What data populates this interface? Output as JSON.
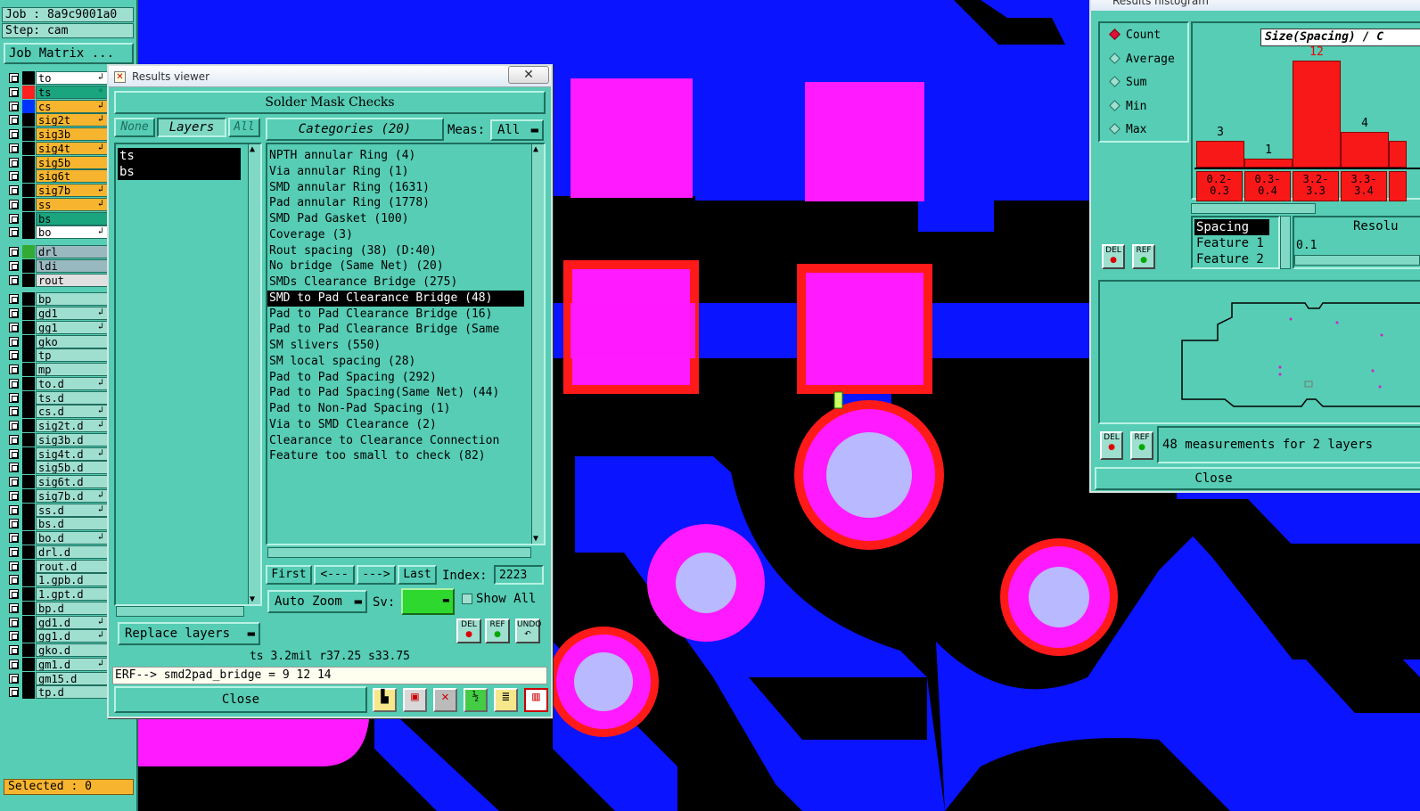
{
  "job_panel": {
    "job": "Job : 8a9c9001a0",
    "step": "Step: cam",
    "matrix_button": "Job Matrix ...",
    "layers": [
      {
        "name": "to",
        "color": "#ffffff",
        "swatch": "#000000",
        "mark": "↲"
      },
      {
        "name": "ts",
        "color": "#1aa57f",
        "swatch": "#ff2020",
        "mark": "◦"
      },
      {
        "name": "cs",
        "color": "#f7b52f",
        "swatch": "#0033ff",
        "mark": "↲"
      },
      {
        "name": "sig2t",
        "color": "#f7b52f",
        "swatch": "#000000",
        "mark": "↲"
      },
      {
        "name": "sig3b",
        "color": "#f7b52f",
        "swatch": "#000000",
        "mark": ""
      },
      {
        "name": "sig4t",
        "color": "#f7b52f",
        "swatch": "#000000",
        "mark": "↲"
      },
      {
        "name": "sig5b",
        "color": "#f7b52f",
        "swatch": "#000000",
        "mark": ""
      },
      {
        "name": "sig6t",
        "color": "#f7b52f",
        "swatch": "#000000",
        "mark": ""
      },
      {
        "name": "sig7b",
        "color": "#f7b52f",
        "swatch": "#000000",
        "mark": "↲"
      },
      {
        "name": "ss",
        "color": "#f7b52f",
        "swatch": "#000000",
        "mark": "↲"
      },
      {
        "name": "bs",
        "color": "#1aa57f",
        "swatch": "#000000",
        "mark": ""
      },
      {
        "name": "bo",
        "color": "#ffffff",
        "swatch": "#000000",
        "mark": "↲"
      },
      {
        "name": "drl",
        "color": "#9ab8c0",
        "swatch": "#33aa33",
        "mark": ""
      },
      {
        "name": "ldi",
        "color": "#9ab8c0",
        "swatch": "#000000",
        "mark": ""
      },
      {
        "name": "rout",
        "color": "#e0e0e0",
        "swatch": "#000000",
        "mark": ""
      },
      {
        "name": "bp",
        "color": "#9fdfd0",
        "swatch": "#000000",
        "mark": ""
      },
      {
        "name": "gd1",
        "color": "#9fdfd0",
        "swatch": "#000000",
        "mark": "↲"
      },
      {
        "name": "gg1",
        "color": "#9fdfd0",
        "swatch": "#000000",
        "mark": "↲"
      },
      {
        "name": "gko",
        "color": "#9fdfd0",
        "swatch": "#000000",
        "mark": ""
      },
      {
        "name": "tp",
        "color": "#9fdfd0",
        "swatch": "#000000",
        "mark": ""
      },
      {
        "name": "mp",
        "color": "#9fdfd0",
        "swatch": "#000000",
        "mark": ""
      },
      {
        "name": "to.d",
        "color": "#9fdfd0",
        "swatch": "#000000",
        "mark": "↲"
      },
      {
        "name": "ts.d",
        "color": "#9fdfd0",
        "swatch": "#000000",
        "mark": ""
      },
      {
        "name": "cs.d",
        "color": "#9fdfd0",
        "swatch": "#000000",
        "mark": "↲"
      },
      {
        "name": "sig2t.d",
        "color": "#9fdfd0",
        "swatch": "#000000",
        "mark": "↲"
      },
      {
        "name": "sig3b.d",
        "color": "#9fdfd0",
        "swatch": "#000000",
        "mark": ""
      },
      {
        "name": "sig4t.d",
        "color": "#9fdfd0",
        "swatch": "#000000",
        "mark": "↲"
      },
      {
        "name": "sig5b.d",
        "color": "#9fdfd0",
        "swatch": "#000000",
        "mark": ""
      },
      {
        "name": "sig6t.d",
        "color": "#9fdfd0",
        "swatch": "#000000",
        "mark": ""
      },
      {
        "name": "sig7b.d",
        "color": "#9fdfd0",
        "swatch": "#000000",
        "mark": "↲"
      },
      {
        "name": "ss.d",
        "color": "#9fdfd0",
        "swatch": "#000000",
        "mark": "↲"
      },
      {
        "name": "bs.d",
        "color": "#9fdfd0",
        "swatch": "#000000",
        "mark": ""
      },
      {
        "name": "bo.d",
        "color": "#9fdfd0",
        "swatch": "#000000",
        "mark": "↲"
      },
      {
        "name": "drl.d",
        "color": "#9fdfd0",
        "swatch": "#000000",
        "mark": ""
      },
      {
        "name": "rout.d",
        "color": "#9fdfd0",
        "swatch": "#000000",
        "mark": ""
      },
      {
        "name": "1.gpb.d",
        "color": "#9fdfd0",
        "swatch": "#000000",
        "mark": ""
      },
      {
        "name": "1.gpt.d",
        "color": "#9fdfd0",
        "swatch": "#000000",
        "mark": ""
      },
      {
        "name": "bp.d",
        "color": "#9fdfd0",
        "swatch": "#000000",
        "mark": ""
      },
      {
        "name": "gd1.d",
        "color": "#9fdfd0",
        "swatch": "#000000",
        "mark": "↲"
      },
      {
        "name": "gg1.d",
        "color": "#9fdfd0",
        "swatch": "#000000",
        "mark": "↲"
      },
      {
        "name": "gko.d",
        "color": "#9fdfd0",
        "swatch": "#000000",
        "mark": ""
      },
      {
        "name": "gm1.d",
        "color": "#9fdfd0",
        "swatch": "#000000",
        "mark": "↲"
      },
      {
        "name": "gm15.d",
        "color": "#9fdfd0",
        "swatch": "#000000",
        "mark": ""
      },
      {
        "name": "tp.d",
        "color": "#9fdfd0",
        "swatch": "#000000",
        "mark": ""
      }
    ],
    "selected": "Selected : 0"
  },
  "results_viewer": {
    "window_title": "Results viewer",
    "close_x": "✕",
    "heading": "Solder Mask Checks",
    "none_button": "None",
    "layers_button": "Layers",
    "all_button": "All",
    "layers": [
      "ts",
      "bs"
    ],
    "categories_button": "Categories (20)",
    "meas_label": "Meas:",
    "meas_value": "All",
    "categories": [
      "NPTH annular Ring (4)",
      "Via annular Ring (1)",
      "SMD annular Ring (1631)",
      "Pad annular Ring (1778)",
      "SMD Pad Gasket (100)",
      "Coverage (3)",
      "Rout spacing (38)           (D:40)",
      "No bridge (Same Net) (20)",
      "SMDs Clearance Bridge (275)",
      "SMD to Pad Clearance Bridge (48)",
      "Pad to Pad Clearance Bridge (16)",
      "Pad to Pad Clearance Bridge (Same",
      "SM slivers (550)",
      "SM local spacing (28)",
      "Pad to Pad Spacing (292)",
      "Pad to Pad Spacing(Same Net) (44)",
      "Pad to Non-Pad Spacing (1)",
      "Via to SMD Clearance (2)",
      "Clearance to Clearance Connection",
      "Feature too small to check (82)"
    ],
    "selected_category_index": 9,
    "nav": {
      "first": "First",
      "prev": "<---",
      "next": "--->",
      "last": "Last",
      "index_label": "Index:",
      "index_value": "2223"
    },
    "auto_zoom": "Auto Zoom",
    "sv_label": "Sv:",
    "show_all": "Show All",
    "replace_layers": "Replace layers",
    "status": "ts 3.2mil  r37.25  s33.75",
    "erf": "ERF--> smd2pad_bridge = 9 12 14",
    "close": "Close",
    "del": "DEL",
    "ref": "REF",
    "undo": "UNDO"
  },
  "histogram": {
    "window_title": "Results histogram",
    "options": [
      "Count",
      "Average",
      "Sum",
      "Min",
      "Max"
    ],
    "selected_option": "Count",
    "chart_title": "Size(Spacing) / C",
    "bins": [
      "0.2-\n0.3",
      "0.3-\n0.4",
      "3.2-\n3.3",
      "3.3-\n3.4",
      ""
    ],
    "counts": [
      3,
      1,
      12,
      4,
      null
    ],
    "attr_list": [
      "Spacing",
      "Feature 1",
      "Feature 2"
    ],
    "resolution_label": "Resolu",
    "resolution_value": "0.1",
    "measurements_text": "48 measurements for 2 layers",
    "close": "Close",
    "del": "DEL",
    "ref": "REF"
  }
}
